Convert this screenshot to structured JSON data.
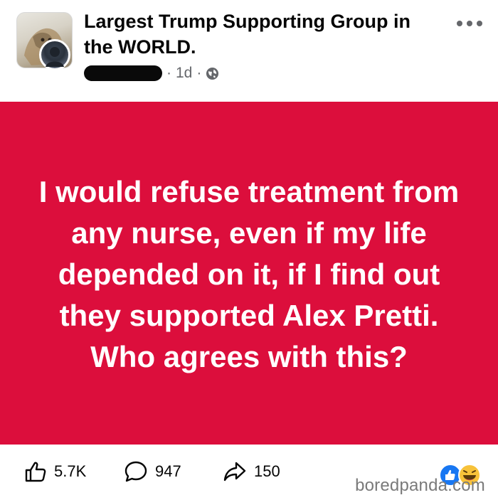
{
  "header": {
    "group_title": "Largest Trump Supporting Group in the WORLD.",
    "time_label": "1d",
    "separator": "·",
    "group_avatar_icon": "lion-photo-icon",
    "user_avatar_icon": "user-photo-icon",
    "audience_icon": "globe-icon",
    "more_icon": "more-options-icon"
  },
  "post": {
    "text": "I would refuse treatment from any nurse, even if my life depended on it, if I find out they supported Alex Pretti. Who agrees with this?",
    "background_color": "#dc0e3c"
  },
  "footer": {
    "likes": "5.7K",
    "comments": "947",
    "shares": "150",
    "like_icon": "thumbs-up-icon",
    "comment_icon": "comment-bubble-icon",
    "share_icon": "share-arrow-icon",
    "reaction_icons": [
      "like-reaction-icon",
      "haha-reaction-icon"
    ]
  },
  "watermark": {
    "text": "boredpanda.com"
  }
}
